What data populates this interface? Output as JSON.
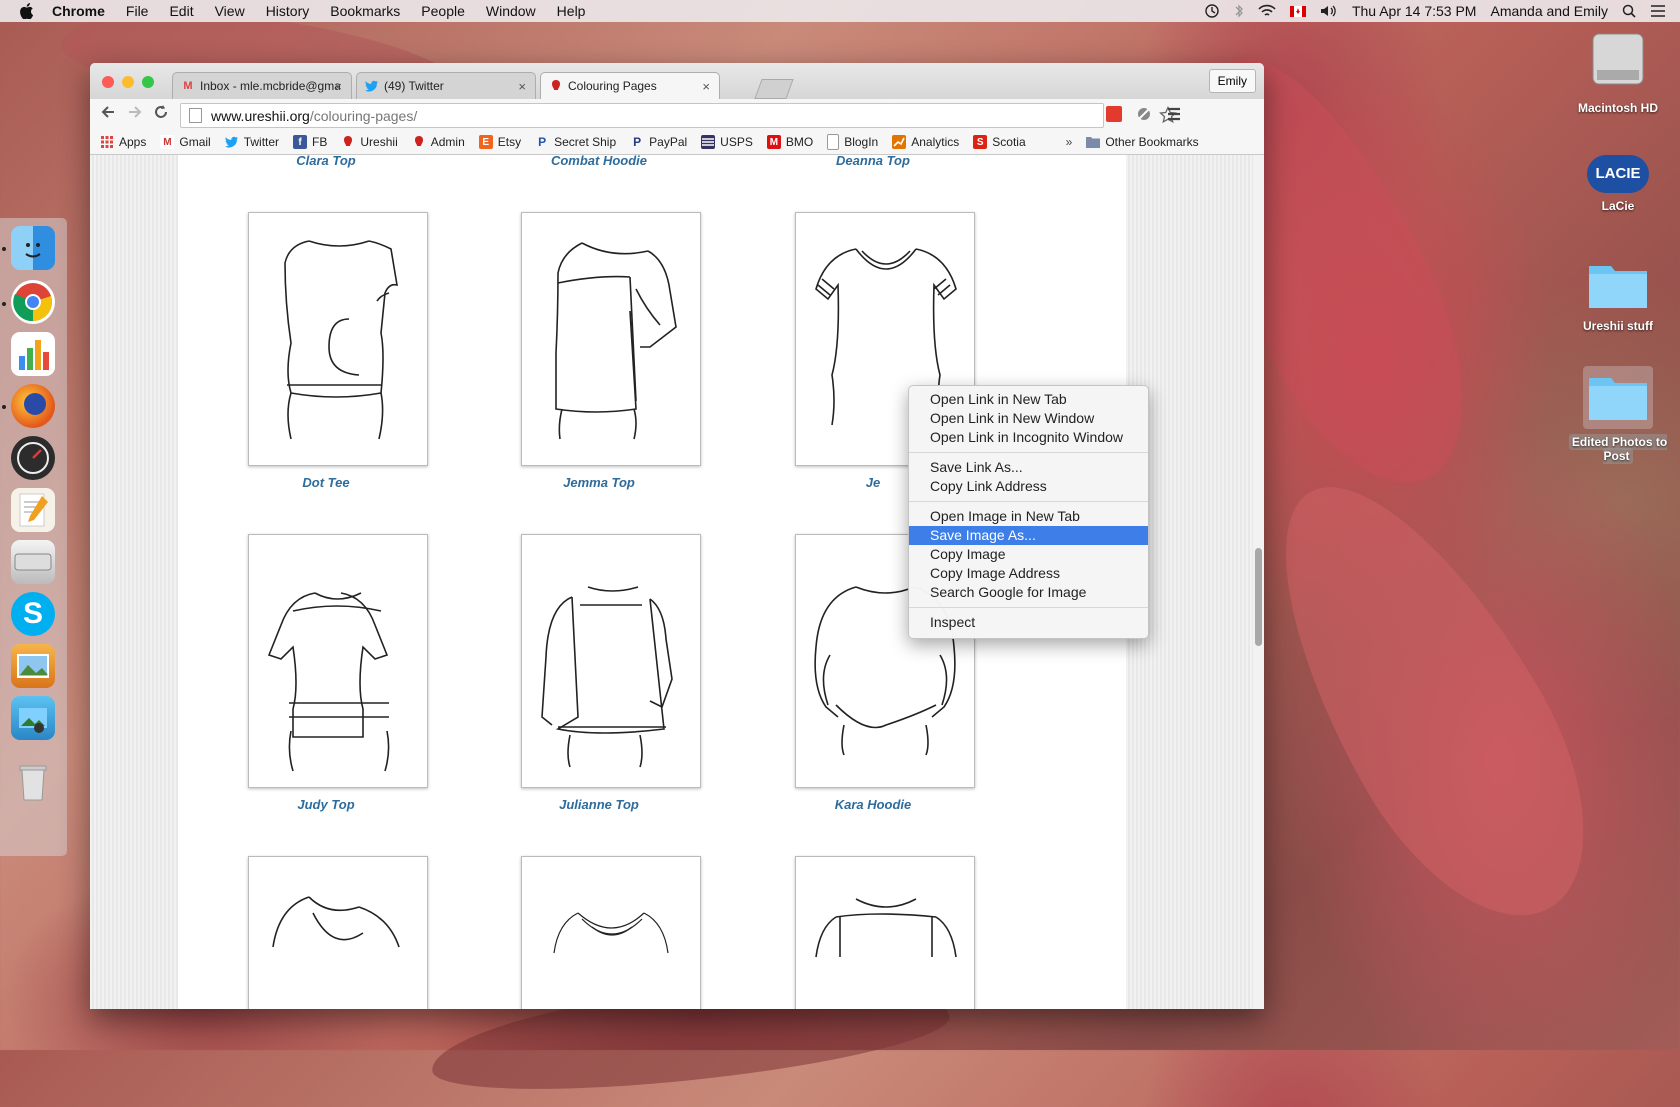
{
  "menubar": {
    "apple": "",
    "app_name": "Chrome",
    "items": [
      "File",
      "Edit",
      "View",
      "History",
      "Bookmarks",
      "People",
      "Window",
      "Help"
    ],
    "clock": "Thu Apr 14  7:53 PM",
    "user": "Amanda and Emily"
  },
  "desktop": {
    "icons": [
      "Macintosh HD",
      "LaCie",
      "Ureshii stuff",
      "Edited Photos to Post"
    ],
    "lacie_badge": "LACIE"
  },
  "dock": {
    "apps": [
      "finder-icon",
      "chrome-icon",
      "numbers-icon",
      "firefox-icon",
      "dashboard-icon",
      "pages-icon",
      "drive-icon",
      "skype-icon",
      "preview-icon",
      "iphoto-icon",
      "trash-icon"
    ],
    "skype_letter": "S"
  },
  "browser": {
    "profile": "Emily",
    "tabs": [
      {
        "title": "Inbox - mle.mcbride@gmail",
        "icon": "M",
        "close": "×"
      },
      {
        "title": "(49) Twitter",
        "icon": "",
        "close": "×"
      },
      {
        "title": "Colouring Pages",
        "icon": "",
        "close": "×"
      }
    ],
    "url_domain": "www.ureshii.org",
    "url_path": "/colouring-pages/",
    "bookmarks": [
      {
        "label": "Apps",
        "color": "#d44"
      },
      {
        "label": "Gmail",
        "color": "#c33"
      },
      {
        "label": "Twitter",
        "color": "#1da1f2"
      },
      {
        "label": "FB",
        "color": "#3b5998"
      },
      {
        "label": "Ureshii",
        "color": "#c22"
      },
      {
        "label": "Admin",
        "color": "#c22"
      },
      {
        "label": "Etsy",
        "color": "#f1641e"
      },
      {
        "label": "Secret Ship",
        "color": "#2255aa"
      },
      {
        "label": "PayPal",
        "color": "#253b80"
      },
      {
        "label": "USPS",
        "color": "#336"
      },
      {
        "label": "BMO",
        "color": "#d11"
      },
      {
        "label": "BlogIn",
        "color": "#aaa"
      },
      {
        "label": "Analytics",
        "color": "#e37400"
      },
      {
        "label": "Scotia",
        "color": "#d21"
      }
    ],
    "more": "»",
    "other_bookmarks": "Other Bookmarks"
  },
  "page": {
    "labels": [
      "Clara Top",
      "Combat Hoodie",
      "Deanna Top",
      "Dot Tee",
      "Jemma Top",
      "Je",
      "Judy Top",
      "Julianne Top",
      "Kara Hoodie"
    ]
  },
  "context_menu": {
    "groups": [
      [
        "Open Link in New Tab",
        "Open Link in New Window",
        "Open Link in Incognito Window"
      ],
      [
        "Save Link As...",
        "Copy Link Address"
      ],
      [
        "Open Image in New Tab",
        "Save Image As...",
        "Copy Image",
        "Copy Image Address",
        "Search Google for Image"
      ],
      [
        "Inspect"
      ]
    ],
    "highlighted": "Save Image As..."
  },
  "colors": {
    "accent": "#3d7ee8",
    "label_blue": "#2e6c9c"
  }
}
